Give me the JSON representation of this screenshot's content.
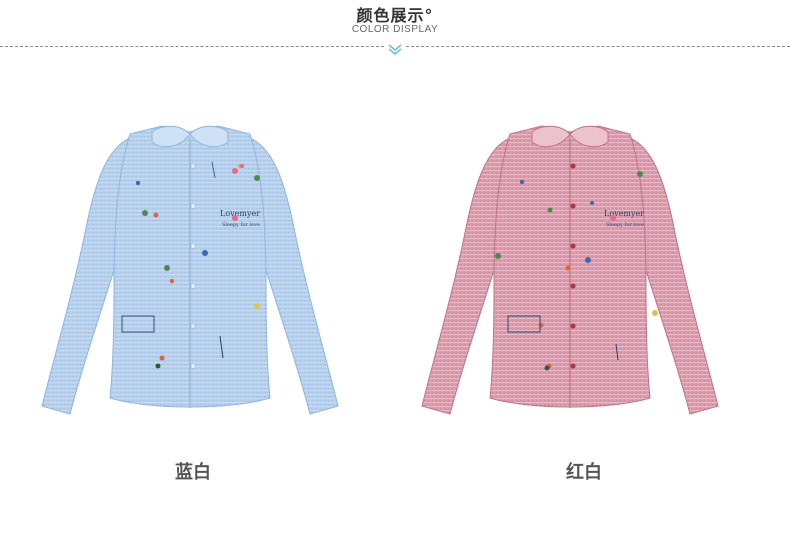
{
  "header": {
    "title": "颜色展示°",
    "subtitle": "COLOR DISPLAY"
  },
  "products": [
    {
      "caption": "蓝白",
      "color": "#a9c8ec",
      "stripe": "#cfe1f6",
      "shade": "#8db4e0"
    },
    {
      "caption": "红白",
      "color": "#d58fa1",
      "stripe": "#ebc2cd",
      "shade": "#c07186"
    }
  ],
  "shirt_text": {
    "line1": "Lovemyer",
    "line2": "Sleepy for love"
  },
  "colors": {
    "accent": "#6cc3c0",
    "divider": "#8a8a8a"
  }
}
